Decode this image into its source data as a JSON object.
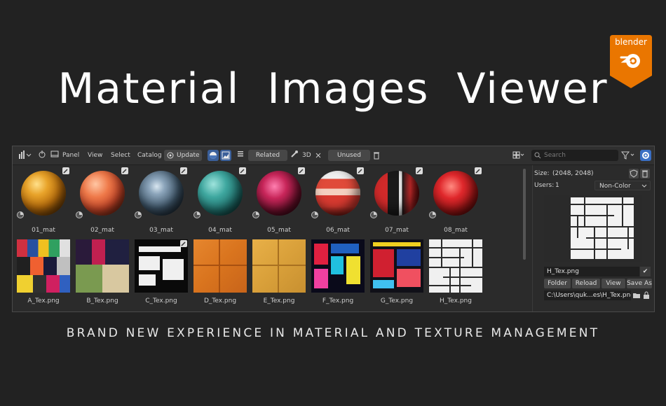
{
  "title": "Material  Images  Viewer",
  "subtitle": "BRAND NEW EXPERIENCE IN MATERIAL AND TEXTURE MANAGEMENT",
  "logo_text": "blender",
  "toolbar": {
    "panel": "Panel",
    "view": "View",
    "select": "Select",
    "catalog": "Catalog",
    "update": "Update",
    "related": "Related",
    "three_d": "3D",
    "unused": "Unused",
    "search_placeholder": "Search"
  },
  "materials": [
    {
      "label": "01_mat",
      "color": "#c7861a",
      "icon": "sphere-gold"
    },
    {
      "label": "02_mat",
      "color": "#e4633c",
      "icon": "sphere-orange"
    },
    {
      "label": "03_mat",
      "color": "#5a7088",
      "icon": "sphere-glass"
    },
    {
      "label": "04_mat",
      "color": "#3a9e96",
      "icon": "sphere-teal"
    },
    {
      "label": "05_mat",
      "color": "#b0243e",
      "icon": "sphere-magenta"
    },
    {
      "label": "06_mat",
      "color": "#d84a3a",
      "icon": "sphere-striped"
    },
    {
      "label": "07_mat",
      "color": "#c42a2a",
      "icon": "sphere-red-dark"
    },
    {
      "label": "08_mat",
      "color": "#d5232b",
      "icon": "sphere-red"
    }
  ],
  "textures": [
    {
      "label": "A_Tex.png"
    },
    {
      "label": "B_Tex.png"
    },
    {
      "label": "C_Tex.png"
    },
    {
      "label": "D_Tex.png"
    },
    {
      "label": "E_Tex.png"
    },
    {
      "label": "F_Tex.png"
    },
    {
      "label": "G_Tex.png"
    },
    {
      "label": "H_Tex.png"
    }
  ],
  "sidebar": {
    "size_label": "Size:",
    "size_value": "(2048, 2048)",
    "users_label": "Users:",
    "users_value": "1",
    "colorspace": "Non-Color",
    "image_name": "H_Tex.png",
    "buttons": [
      "Folder",
      "Reload",
      "View",
      "Save As"
    ],
    "path": "C:\\Users\\quk...es\\H_Tex.png"
  },
  "colors": {
    "accent": "#3a5f9a",
    "logo": "#ea7600"
  }
}
